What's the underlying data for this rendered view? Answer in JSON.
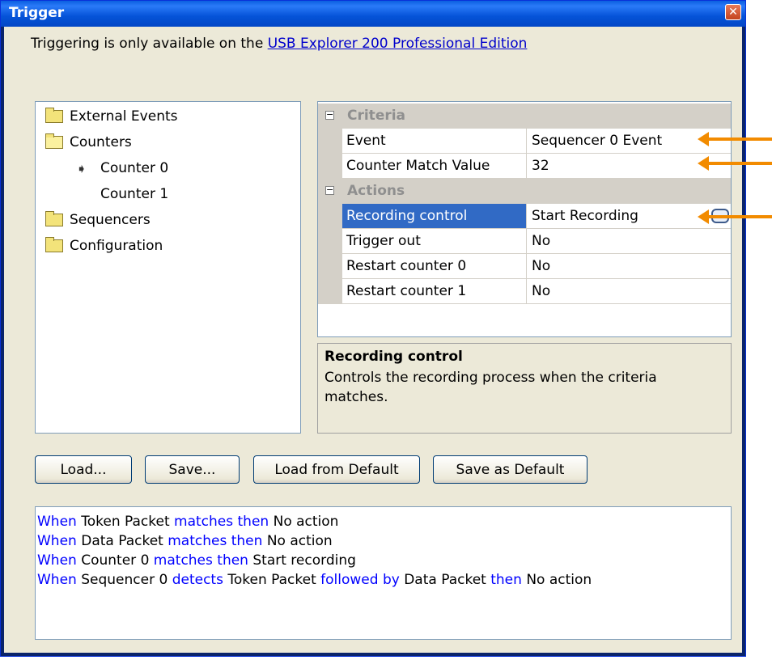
{
  "window": {
    "title": "Trigger"
  },
  "info": {
    "prefix": "Triggering is only available on the ",
    "link": "USB Explorer 200 Professional Edition"
  },
  "tree": {
    "items": [
      {
        "label": "External Events",
        "icon": "folder-icon"
      },
      {
        "label": "Counters",
        "icon": "folder-open-icon"
      },
      {
        "label": "Counter 0",
        "icon": "arrow-right-icon"
      },
      {
        "label": "Counter 1",
        "icon": ""
      },
      {
        "label": "Sequencers",
        "icon": "folder-icon"
      },
      {
        "label": "Configuration",
        "icon": "folder-icon"
      }
    ]
  },
  "grid": {
    "criteria": {
      "label": "Criteria",
      "rows": [
        {
          "name": "Event",
          "value": "Sequencer 0 Event"
        },
        {
          "name": "Counter Match Value",
          "value": "32"
        }
      ]
    },
    "actions": {
      "label": "Actions",
      "rows": [
        {
          "name": "Recording control",
          "value": "Start Recording"
        },
        {
          "name": "Trigger out",
          "value": "No"
        },
        {
          "name": "Restart counter 0",
          "value": "No"
        },
        {
          "name": "Restart counter 1",
          "value": "No"
        }
      ]
    }
  },
  "description": {
    "title": "Recording control",
    "text": "Controls the recording process when the criteria matches."
  },
  "buttons": {
    "load": "Load...",
    "save": "Save...",
    "load_default": "Load from Default",
    "save_default": "Save as Default"
  },
  "log": [
    [
      {
        "t": "When",
        "kw": true
      },
      {
        "t": " Token Packet "
      },
      {
        "t": "matches then",
        "kw": true
      },
      {
        "t": " No action"
      }
    ],
    [
      {
        "t": "When",
        "kw": true
      },
      {
        "t": " Data Packet "
      },
      {
        "t": "matches then",
        "kw": true
      },
      {
        "t": " No action"
      }
    ],
    [
      {
        "t": "When",
        "kw": true
      },
      {
        "t": " Counter 0 "
      },
      {
        "t": "matches then",
        "kw": true
      },
      {
        "t": " Start recording"
      }
    ],
    [
      {
        "t": "When",
        "kw": true
      },
      {
        "t": " Sequencer 0 "
      },
      {
        "t": "detects",
        "kw": true
      },
      {
        "t": " Token Packet "
      },
      {
        "t": "followed by",
        "kw": true
      },
      {
        "t": " Data Packet "
      },
      {
        "t": "then",
        "kw": true
      },
      {
        "t": " No action"
      }
    ]
  ],
  "colors": {
    "keyword": "#0000ff",
    "annotation_arrow": "#f28b00",
    "selection": "#316ac5"
  }
}
